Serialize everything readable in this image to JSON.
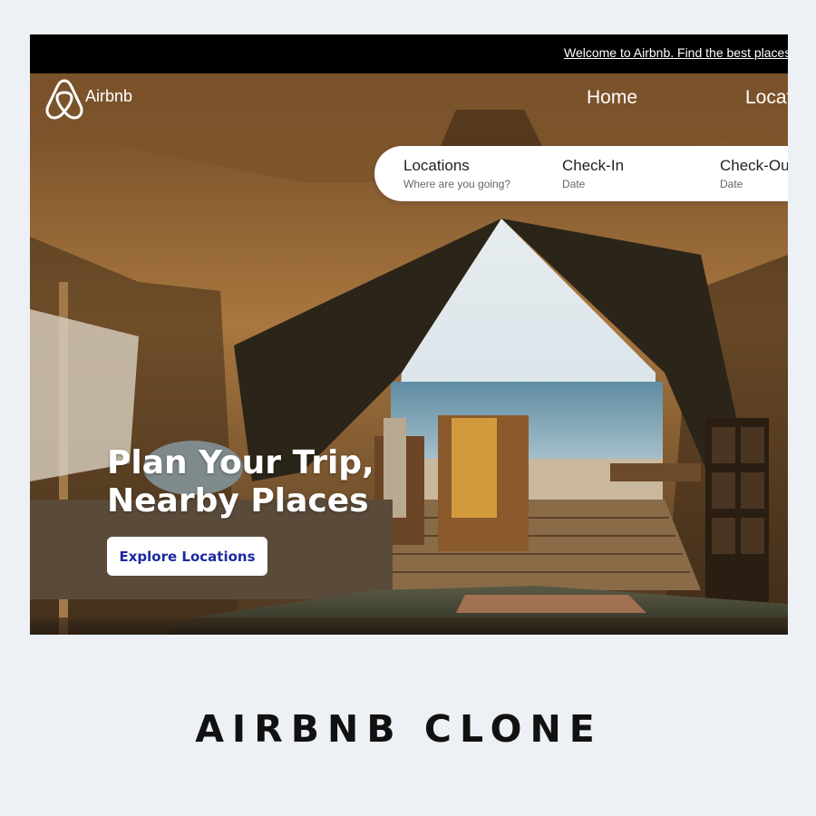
{
  "banner": {
    "text": "Welcome to Airbnb. Find the best places"
  },
  "nav": {
    "brand": "Airbnb",
    "links": [
      "Home",
      "Locations"
    ]
  },
  "search": {
    "fields": [
      {
        "label": "Locations",
        "hint": "Where are you going?"
      },
      {
        "label": "Check-In",
        "hint": "Date"
      },
      {
        "label": "Check-Out",
        "hint": "Date"
      }
    ]
  },
  "hero": {
    "headline": [
      "Plan Your Trip,",
      "Nearby Places"
    ],
    "cta": "Explore Locations"
  },
  "caption": "AIRBNB CLONE",
  "colors": {
    "banner": "#000000",
    "cta_text": "#1c2aa0",
    "page_bg": "#edf1f5"
  }
}
